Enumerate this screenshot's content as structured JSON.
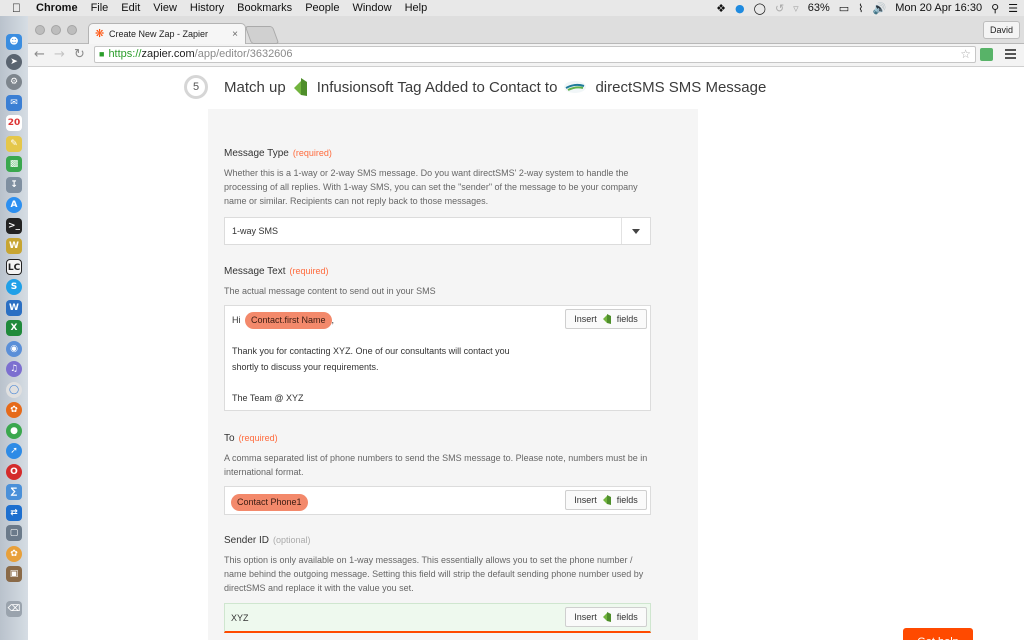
{
  "menubar": {
    "apple": "",
    "items": [
      "Chrome",
      "File",
      "Edit",
      "View",
      "History",
      "Bookmarks",
      "People",
      "Window",
      "Help"
    ],
    "battery": "63%",
    "clock": "Mon 20 Apr  16:30"
  },
  "browser": {
    "tab_title": "Create New Zap - Zapier",
    "tab_close": "×",
    "profile": "David",
    "url_scheme": "https://",
    "url_host": "zapier.com",
    "url_path": "/app/editor/3632606"
  },
  "step": {
    "number": "5",
    "title_prefix": "Match up",
    "trigger_app": "Infusionsoft Tag Added to Contact to",
    "action_app": "directSMS SMS Message"
  },
  "message_type": {
    "label": "Message Type",
    "required": "(required)",
    "description": "Whether this is a 1-way or 2-way SMS message. Do you want directSMS' 2-way system to handle the processing of all replies. With 1-way SMS, you can set the \"sender\" of the message to be your company name or similar. Recipients can not reply back to those messages.",
    "value": "1-way SMS"
  },
  "message_text": {
    "label": "Message Text",
    "required": "(required)",
    "description": "The actual message content to send out in your SMS",
    "greeting": "Hi",
    "pill": "Contact.first Name",
    "comma": ",",
    "line1": "Thank you for contacting XYZ. One of our consultants will contact you",
    "line2": "shortly to discuss your requirements.",
    "signoff": "The Team @ XYZ"
  },
  "to_field": {
    "label": "To",
    "required": "(required)",
    "description": "A comma separated list of phone numbers to send the SMS message to. Please note, numbers must be in international format.",
    "pill": "Contact Phone1"
  },
  "sender_id": {
    "label": "Sender ID",
    "optional": "(optional)",
    "description": "This option is only available on 1-way messages. This essentially allows you to set the phone number / name behind the outgoing message. Setting this field will strip the default sending phone number used by directSMS and replace it with the value you set.",
    "value": "XYZ"
  },
  "insert": {
    "label_left": "Insert",
    "label_right": "fields"
  },
  "get_help": "Get help",
  "colors": {
    "accent": "#ff4a00",
    "pill": "#f3896b",
    "required": "#ff6b3d",
    "panel": "#f5f5f5"
  }
}
